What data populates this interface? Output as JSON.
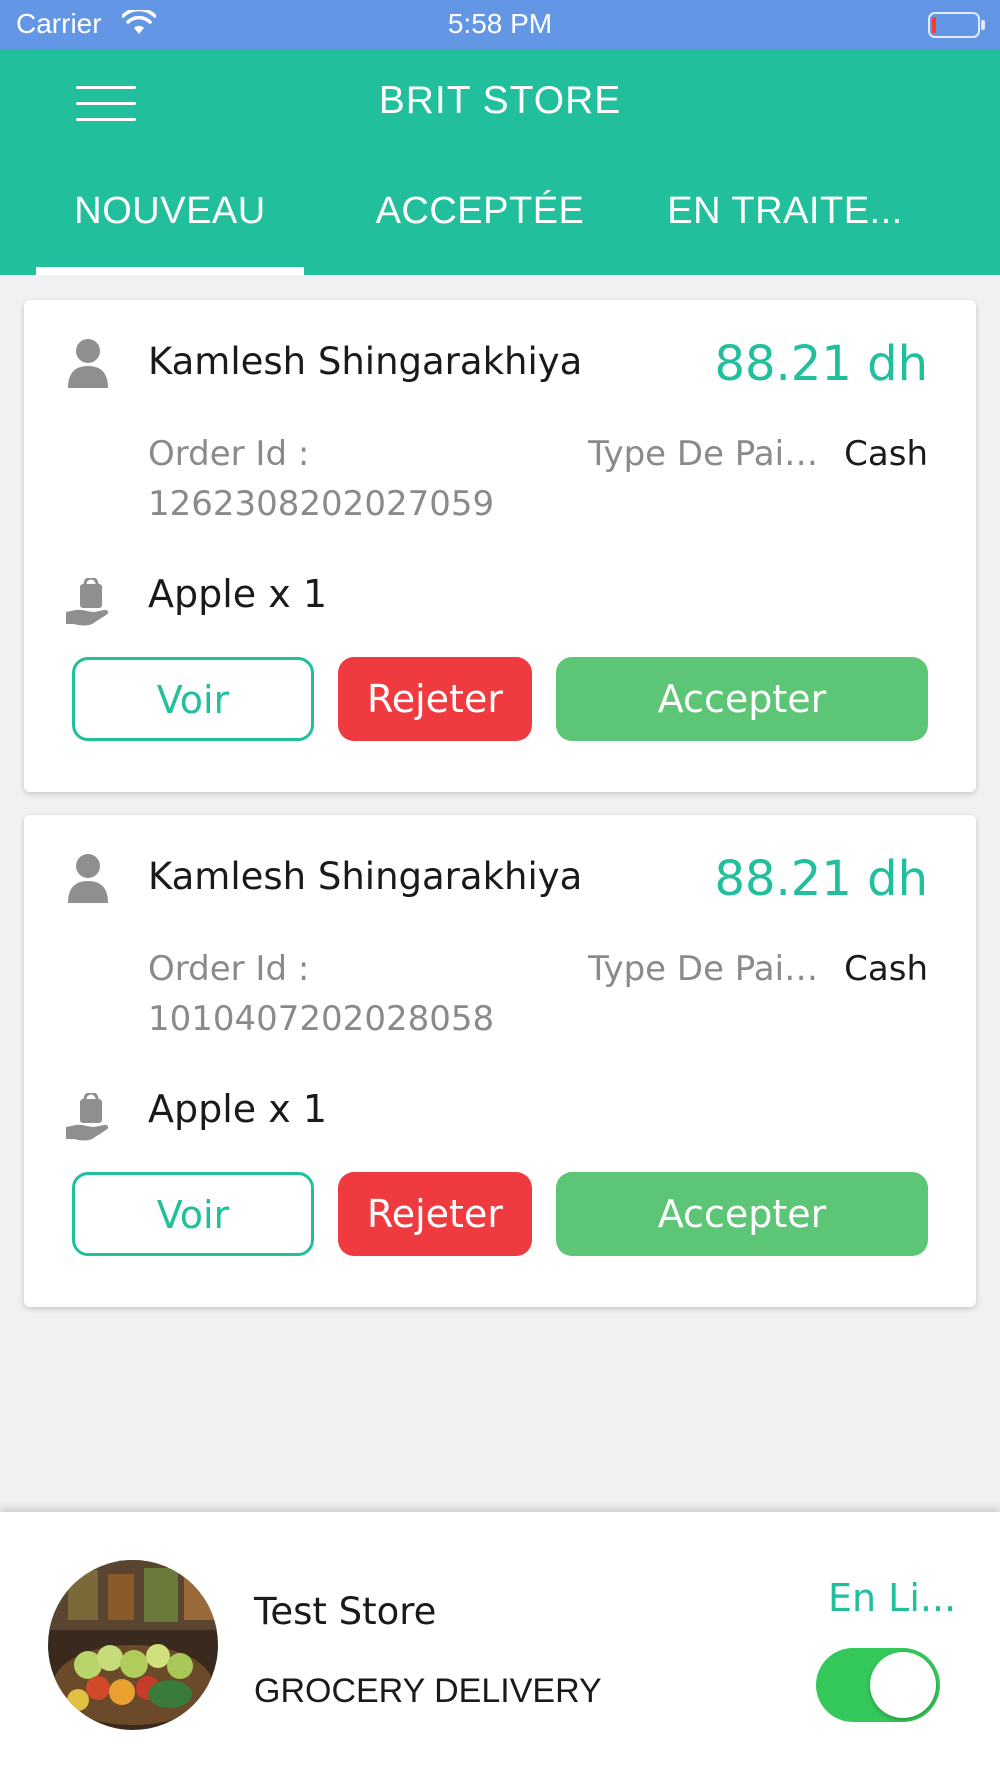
{
  "status_bar": {
    "carrier": "Carrier",
    "time": "5:58 PM",
    "icons": [
      "wifi-icon",
      "battery-icon"
    ]
  },
  "header": {
    "title": "BRIT STORE",
    "menu_icon": "menu-icon"
  },
  "tabs": [
    {
      "label": "NOUVEAU",
      "active": true
    },
    {
      "label": "ACCEPTÉE",
      "active": false
    },
    {
      "label": "EN TRAITE..."
    }
  ],
  "orders": [
    {
      "customer": "Kamlesh Shingarakhiya",
      "amount": "88.21 dh",
      "order_id_label": "Order Id :",
      "order_id": "1262308202027059",
      "payment_label": "Type De Paiement",
      "payment_value": "Cash",
      "item": "Apple x 1",
      "view_label": "Voir",
      "reject_label": "Rejeter",
      "accept_label": "Accepter"
    },
    {
      "customer": "Kamlesh Shingarakhiya",
      "amount": "88.21 dh",
      "order_id_label": "Order Id :",
      "order_id": "1010407202028058",
      "payment_label": "Type De Paiement",
      "payment_value": "Cash",
      "item": "Apple x 1",
      "view_label": "Voir",
      "reject_label": "Rejeter",
      "accept_label": "Accepter"
    }
  ],
  "store": {
    "name": "Test Store",
    "type": "GROCERY DELIVERY",
    "status": "En Li...",
    "online": true
  },
  "colors": {
    "primary": "#21bf9c",
    "status_bar": "#6496e6",
    "reject": "#ef3b40",
    "accept": "#5dc576",
    "toggle_on": "#34c759"
  }
}
